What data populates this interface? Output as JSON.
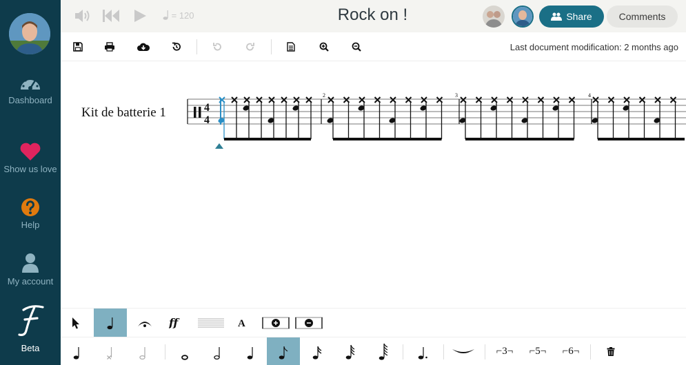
{
  "app": {
    "title": "Rock on !"
  },
  "sidebar": {
    "items": [
      {
        "label": "Dashboard",
        "icon": "dashboard-gauge-icon"
      },
      {
        "label": "Show us love",
        "icon": "heart-icon",
        "color": "#e0245e"
      },
      {
        "label": "Help",
        "icon": "question-icon",
        "color": "#e07a0e"
      },
      {
        "label": "My account",
        "icon": "user-icon"
      }
    ],
    "beta_label": "Beta",
    "logo_letter": "F"
  },
  "header": {
    "tempo_value": "= 120",
    "share_label": "Share",
    "comments_label": "Comments"
  },
  "toolbar": {
    "last_modification": "Last document modification: 2 months ago"
  },
  "score": {
    "instrument_name": "Kit de batterie 1",
    "time_signature": {
      "top": "4",
      "bottom": "4"
    },
    "measure_numbers": [
      "2",
      "3",
      "4"
    ]
  },
  "palette_bottom": {
    "tuplets": [
      "3",
      "5",
      "6"
    ]
  },
  "colors": {
    "sidebar_bg": "#0e3b4b",
    "accent": "#1a6f86",
    "active_tool": "#7fb0c1",
    "selection": "#2a8fc6"
  }
}
